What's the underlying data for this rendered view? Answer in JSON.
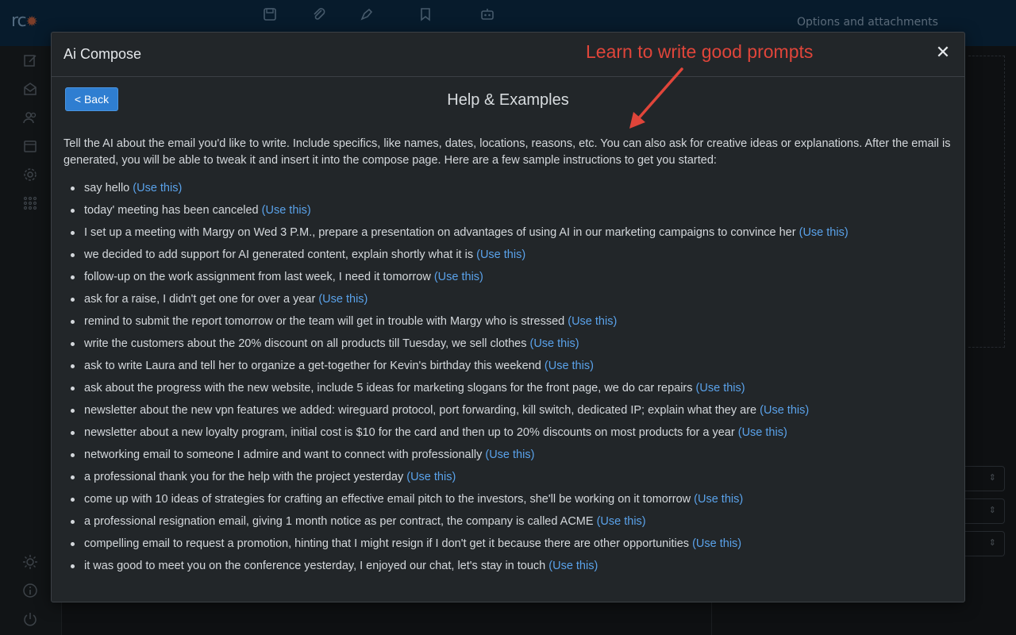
{
  "background": {
    "logo": "rc",
    "options_label": "Options and attachments"
  },
  "modal": {
    "title": "Ai Compose",
    "close_label": "✕",
    "annotation": "Learn to write good prompts",
    "back_label": "< Back",
    "help_title": "Help & Examples",
    "intro": "Tell the AI about the email you'd like to write. Include specifics, like names, dates, locations, reasons, etc. You can also ask for creative ideas or explanations. After the email is generated, you will be able to tweak it and insert it into the compose page. Here are a few sample instructions to get you started:",
    "use_label": "(Use this)",
    "examples": [
      "say hello",
      "today' meeting has been canceled",
      "I set up a meeting with Margy on Wed 3 P.M., prepare a presentation on advantages of using AI in our marketing campaigns to convince her",
      "we decided to add support for AI generated content, explain shortly what it is",
      "follow-up on the work assignment from last week, I need it tomorrow",
      "ask for a raise, I didn't get one for over a year",
      "remind to submit the report tomorrow or the team will get in trouble with Margy who is stressed",
      "write the customers about the 20% discount on all products till Tuesday, we sell clothes",
      "ask to write Laura and tell her to organize a get-together for Kevin's birthday this weekend",
      "ask about the progress with the new website, include 5 ideas for marketing slogans for the front page, we do car repairs",
      "newsletter about the new vpn features we added: wireguard protocol, port forwarding, kill switch, dedicated IP; explain what they are",
      "newsletter about a new loyalty program, initial cost is $10 for the card and then up to 20% discounts on most products for a year",
      "networking email to someone I admire and want to connect with professionally",
      "a professional thank you for the help with the project yesterday",
      "come up with 10 ideas of strategies for crafting an effective email pitch to the investors, she'll be working on it tomorrow",
      "a professional resignation email, giving 1 month notice as per contract, the company is called ACME",
      "compelling email to request a promotion, hinting that I might resign if I don't get it because there are other opportunities",
      "it was good to meet you on the conference yesterday, I enjoyed our chat, let's stay in touch"
    ]
  },
  "colors": {
    "accent": "#2f7ed1",
    "link": "#5aa2ea",
    "annotation": "#e0453a"
  }
}
